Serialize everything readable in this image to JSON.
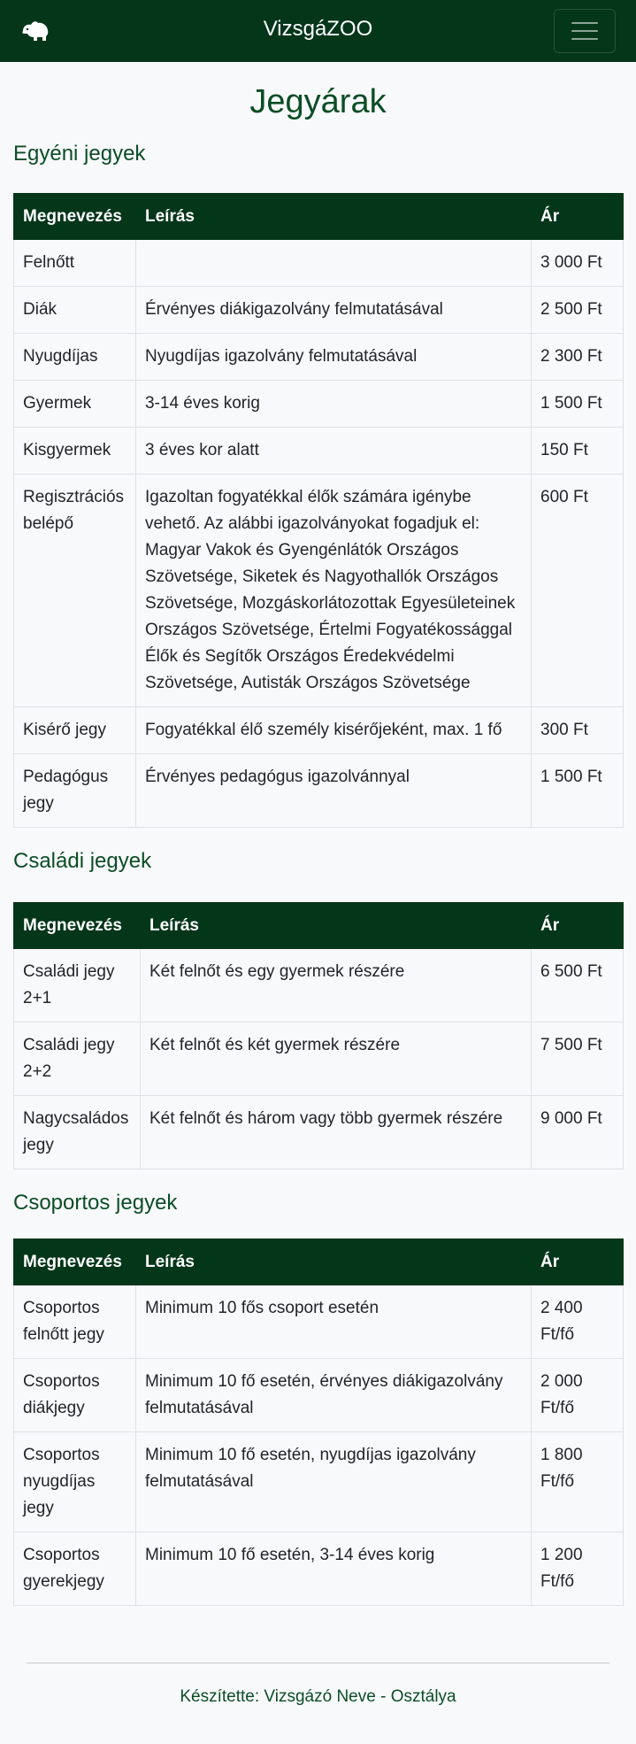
{
  "nav": {
    "brand": "VizsgáZOO",
    "logo_icon": "bear-icon",
    "menu_icon": "hamburger-menu-icon"
  },
  "page": {
    "title": "Jegyárak"
  },
  "sections": [
    {
      "title": "Egyéni jegyek",
      "headers": [
        "Megnevezés",
        "Leírás",
        "Ár"
      ],
      "rows": [
        [
          "Felnőtt",
          "",
          "3 000 Ft"
        ],
        [
          "Diák",
          "Érvényes diákigazolvány felmutatásával",
          "2 500 Ft"
        ],
        [
          "Nyugdíjas",
          "Nyugdíjas igazolvány felmutatásával",
          "2 300 Ft"
        ],
        [
          "Gyermek",
          "3-14 éves korig",
          "1 500 Ft"
        ],
        [
          "Kisgyermek",
          "3 éves kor alatt",
          "150 Ft"
        ],
        [
          "Regisztrációs belépő",
          "Igazoltan fogyatékkal élők számára igénybe vehető. Az alábbi igazolványokat fogadjuk el: Magyar Vakok és Gyengénlátók Országos Szövetsége, Siketek és Nagyothallók Országos Szövetsége, Mozgáskorlátozottak Egyesületeinek Országos Szövetsége, Értelmi Fogyatékossággal Élők és Segítők Országos Éredekvédelmi Szövetsége, Autisták Országos Szövetsége",
          "600 Ft"
        ],
        [
          "Kisérő jegy",
          "Fogyatékkal élő személy kisérőjeként, max. 1 fő",
          "300 Ft"
        ],
        [
          "Pedagógus jegy",
          "Érvényes pedagógus igazolvánnyal",
          "1 500 Ft"
        ]
      ]
    },
    {
      "title": "Családi jegyek",
      "headers": [
        "Megnevezés",
        "Leírás",
        "Ár"
      ],
      "rows": [
        [
          "Családi jegy 2+1",
          "Két felnőt és egy gyermek részére",
          "6 500 Ft"
        ],
        [
          "Családi jegy 2+2",
          "Két felnőt és két gyermek részére",
          "7 500 Ft"
        ],
        [
          "Nagycsaládos jegy",
          "Két felnőt és három vagy több gyermek részére",
          "9 000 Ft"
        ]
      ]
    },
    {
      "title": "Csoportos jegyek",
      "headers": [
        "Megnevezés",
        "Leírás",
        "Ár"
      ],
      "rows": [
        [
          "Csoportos felnőtt jegy",
          "Minimum 10 fős csoport esetén",
          "2 400 Ft/fő"
        ],
        [
          "Csoportos diákjegy",
          "Minimum 10 fő esetén, érvényes diákigazolvány felmutatásával",
          "2 000 Ft/fő"
        ],
        [
          "Csoportos nyugdíjas jegy",
          "Minimum 10 fő esetén, nyugdíjas igazolvány felmutatásával",
          "1 800 Ft/fő"
        ],
        [
          "Csoportos gyerekjegy",
          "Minimum 10 fő esetén, 3-14 éves korig",
          "1 200 Ft/fő"
        ]
      ]
    }
  ],
  "footer": {
    "text": "Készítette: Vizsgázó Neve - Osztálya"
  }
}
